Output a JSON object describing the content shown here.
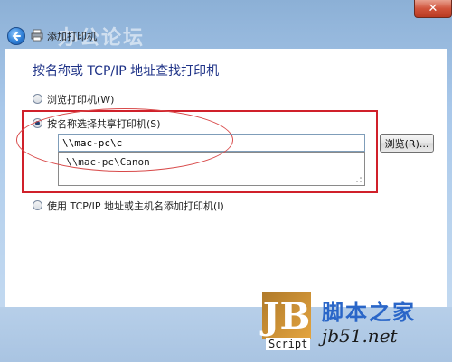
{
  "window": {
    "title": "添加打印机",
    "watermark": "办公论坛",
    "close_label": "✕"
  },
  "page": {
    "heading": "按名称或 TCP/IP 地址查找打印机"
  },
  "options": [
    {
      "label": "浏览打印机(W)",
      "checked": false
    },
    {
      "label": "按名称选择共享打印机(S)",
      "checked": true
    },
    {
      "label": "使用 TCP/IP 地址或主机名添加打印机(I)",
      "checked": false
    }
  ],
  "share_input": {
    "value": "\\\\mac-pc\\c"
  },
  "autocomplete": {
    "items": [
      "\\\\mac-pc\\Canon"
    ]
  },
  "browse_button": {
    "label": "浏览(R)..."
  },
  "branding": {
    "logo_letters": "JB",
    "site_name": "脚本之家",
    "site_url": "jb51.net",
    "tag": "Script"
  },
  "colors": {
    "highlight": "#d0202a",
    "heading": "#1e3287"
  }
}
